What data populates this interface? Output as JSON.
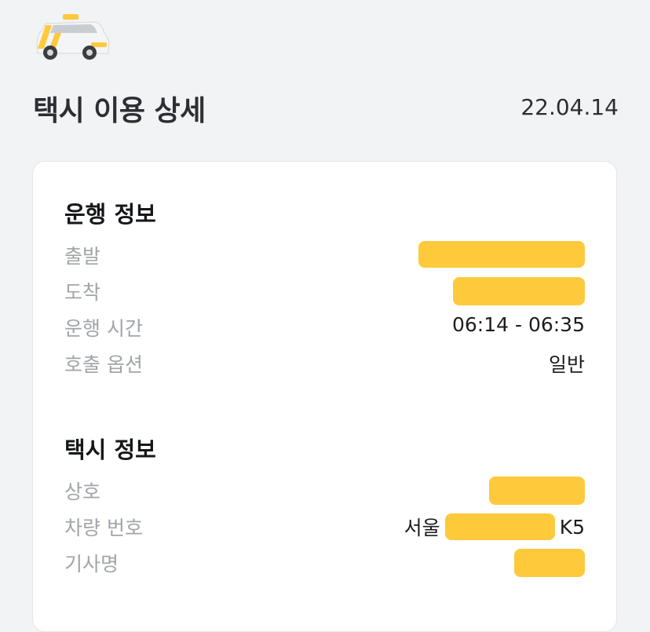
{
  "header": {
    "title": "택시 이용 상세",
    "date": "22.04.14"
  },
  "colors": {
    "background": "#f2f3f5",
    "card": "#ffffff",
    "redaction": "#ffc93c",
    "label": "#a1a4a9",
    "value": "#1c1d20"
  },
  "trip_info": {
    "title": "운행 정보",
    "departure_label": "출발",
    "arrival_label": "도착",
    "time_label": "운행 시간",
    "time_value": "06:14 - 06:35",
    "option_label": "호출 옵션",
    "option_value": "일반"
  },
  "taxi_info": {
    "title": "택시 정보",
    "company_label": "상호",
    "plate_label": "차량 번호",
    "plate_prefix": "서울",
    "plate_suffix": "K5",
    "driver_label": "기사명"
  },
  "icons": {
    "taxi": "taxi-car-icon"
  }
}
